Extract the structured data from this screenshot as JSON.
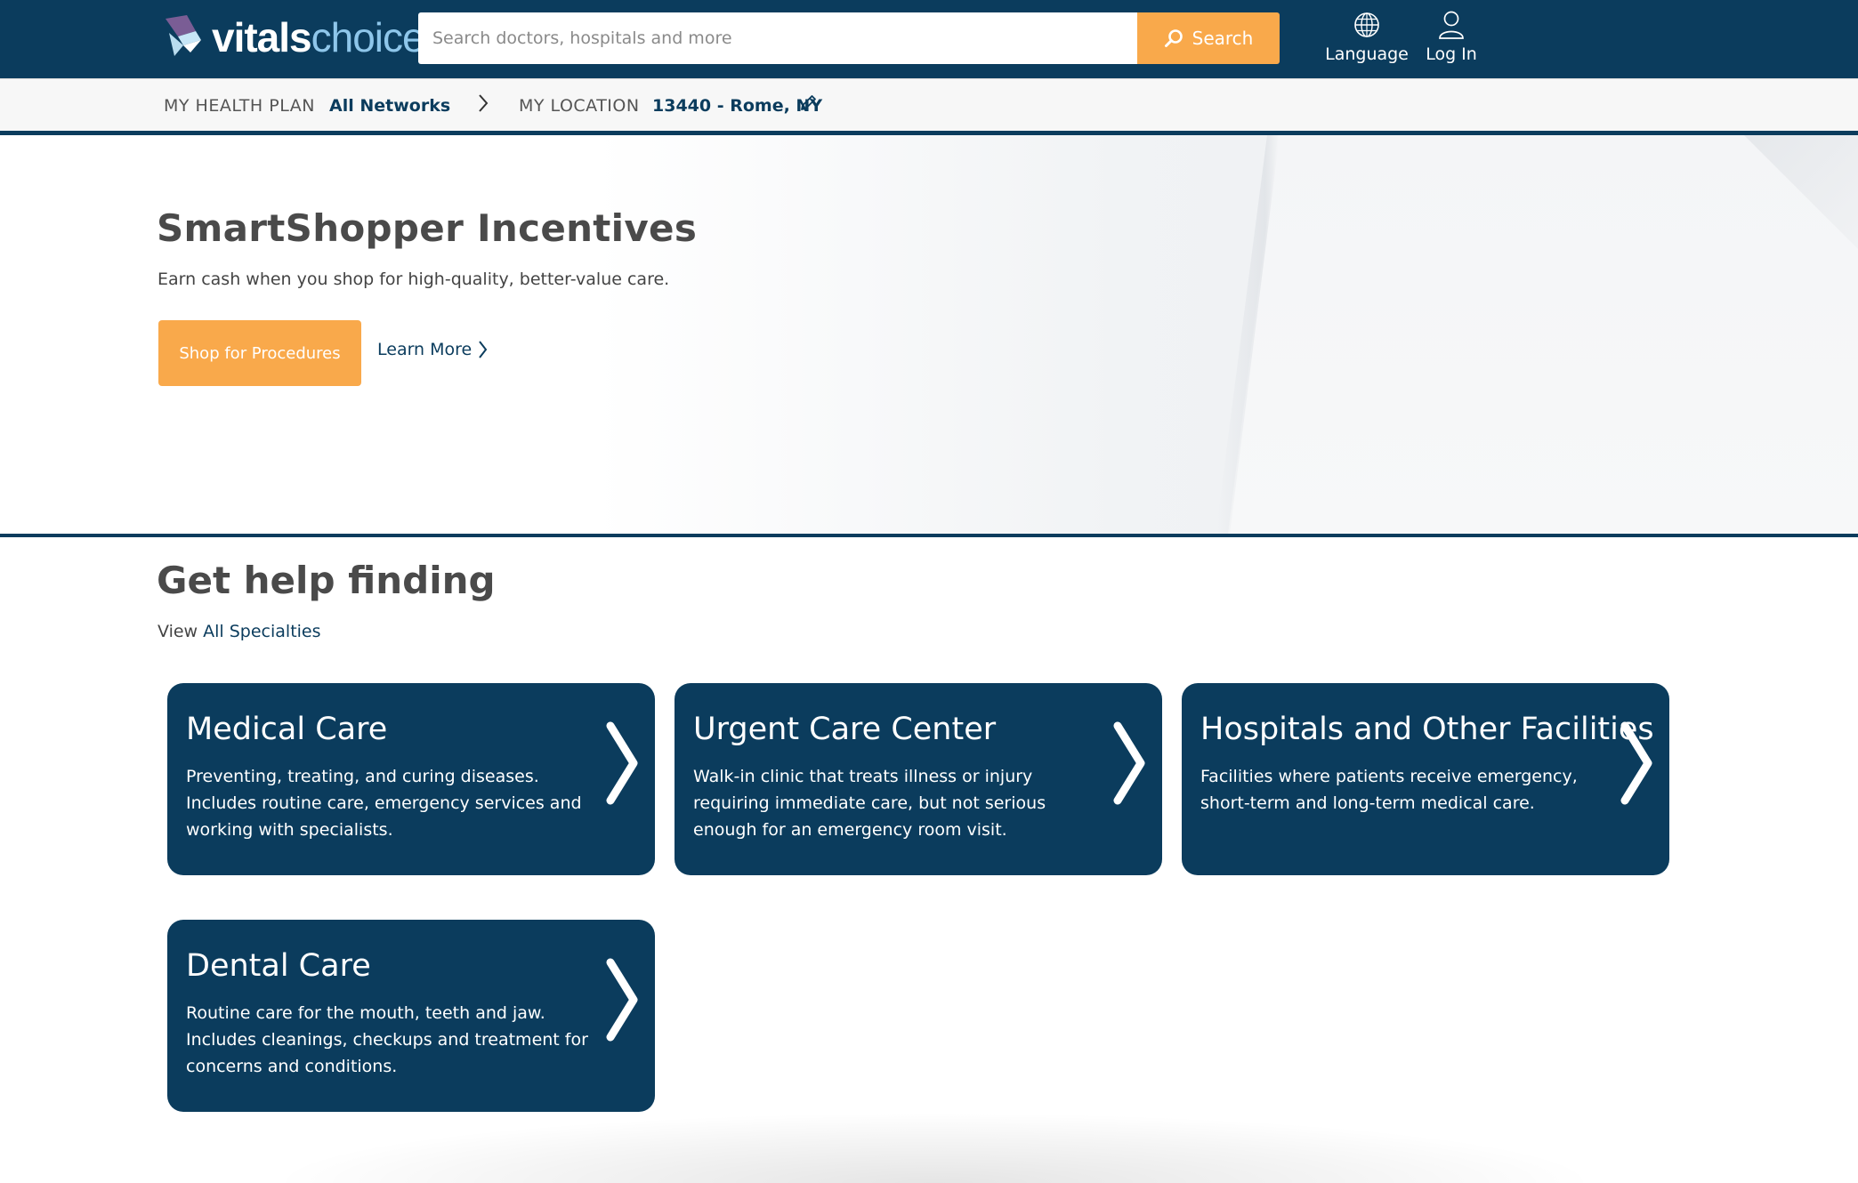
{
  "header": {
    "logo": {
      "part1": "vitals",
      "part2": "choice"
    },
    "search": {
      "placeholder": "Search doctors, hospitals and more",
      "value": "",
      "button_label": "Search"
    },
    "language_label": "Language",
    "login_label": "Log In"
  },
  "plan_bar": {
    "health_plan_label": "MY HEALTH PLAN",
    "health_plan_value": "All Networks",
    "location_label": "MY LOCATION",
    "location_value": "13440 - Rome, NY"
  },
  "hero": {
    "title": "SmartShopper Incentives",
    "subtitle": "Earn cash when you shop for high-quality, better-value care.",
    "primary_button": "Shop for Procedures",
    "link": "Learn More"
  },
  "find": {
    "title": "Get help finding",
    "view_prefix": "View",
    "view_link": "All Specialties",
    "cards": [
      {
        "title": "Medical Care",
        "description": "Preventing, treating, and curing diseases. Includes routine care, emergency services and working with specialists."
      },
      {
        "title": "Urgent Care Center",
        "description": "Walk-in clinic that treats illness or injury requiring immediate care, but not serious enough for an emergency room visit."
      },
      {
        "title": "Hospitals and Other Facilities",
        "description": "Facilities where patients receive emergency, short-term and long-term medical care."
      },
      {
        "title": "Dental Care",
        "description": "Routine care for the mouth, teeth and jaw. Includes cleanings, checkups and treatment for concerns and conditions."
      }
    ]
  },
  "colors": {
    "brand_navy": "#0b3c5d",
    "accent_orange": "#f9a94b",
    "logo_light_blue": "#8ec6ea"
  },
  "icons": {
    "search_button": "search-icon",
    "language": "globe-icon",
    "login": "user-icon",
    "plan_separator": "chevron-right-icon",
    "location_edit": "pencil-icon",
    "learn_more": "chevron-right-icon",
    "card_arrow": "chevron-right-icon"
  }
}
